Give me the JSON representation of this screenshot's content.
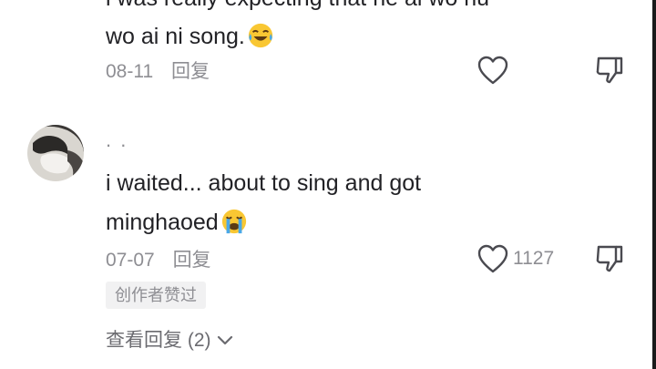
{
  "comment_1": {
    "clipped_text": "i was really expecting that he ai wo nu",
    "text_line": "wo ai ni song.",
    "emoji_icon": "face-with-tears-of-joy-icon",
    "date": "08-11",
    "reply_label": "回复"
  },
  "comment_2": {
    "username": ".           .",
    "text_line_1": "i waited... about to sing and got",
    "text_line_2": "minghaoed",
    "emoji_icon": "loudly-crying-face-icon",
    "date": "07-07",
    "reply_label": "回复",
    "like_count": "1127",
    "badge": "创作者赞过",
    "view_replies": "查看回复 (2)"
  },
  "colors": {
    "text_primary": "#222226",
    "text_secondary": "#8e8e93",
    "badge_bg": "#f1f1f2",
    "emoji_yellow": "#f9c733",
    "tear_blue": "#4aa8e8"
  }
}
